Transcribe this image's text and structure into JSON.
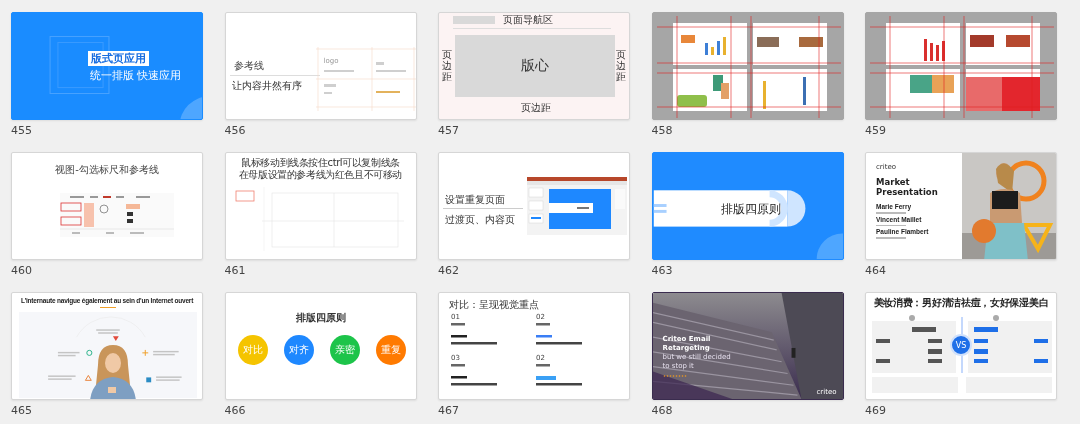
{
  "slides": [
    {
      "number": "455",
      "selected": false,
      "kind": "cover",
      "title": "版式页应用",
      "subtitle": "统一排版 快速应用"
    },
    {
      "number": "456",
      "selected": false,
      "kind": "guides",
      "title": "参考线",
      "subtitle": "让内容井然有序",
      "label": "logo"
    },
    {
      "number": "457",
      "selected": false,
      "kind": "margins",
      "nav": "页面导航区",
      "center": "版心",
      "left": "页边距",
      "right": "页边距",
      "bottom": "页边距"
    },
    {
      "number": "458",
      "selected": false,
      "kind": "collage"
    },
    {
      "number": "459",
      "selected": false,
      "kind": "redcollage"
    },
    {
      "number": "460",
      "selected": false,
      "kind": "ribbon",
      "title": "视图-勾选标尺和参考线"
    },
    {
      "number": "461",
      "selected": false,
      "kind": "notes",
      "lines": [
        "鼠标移动到线条按住ctrl可以复制线条",
        "在母版设置的参考线为红色且不可移动"
      ]
    },
    {
      "number": "462",
      "selected": false,
      "kind": "repeat",
      "title": "设置重复页面",
      "subtitle": "过渡页、内容页"
    },
    {
      "number": "463",
      "selected": false,
      "kind": "section",
      "title": "排版四原则"
    },
    {
      "number": "464",
      "selected": false,
      "kind": "market",
      "logo": "criteo",
      "title": "Market Presentation",
      "names": [
        "Marie Ferry",
        "Vincent Maillet",
        "Pauline Flambert"
      ]
    },
    {
      "number": "465",
      "selected": false,
      "kind": "internaute",
      "title": "L'internaute navigue également au sein d'un Internet ouvert"
    },
    {
      "number": "466",
      "selected": false,
      "kind": "principles",
      "title": "排版四原则",
      "circles": [
        {
          "label": "对比",
          "color": "#f5c400"
        },
        {
          "label": "对齐",
          "color": "#1e88ff"
        },
        {
          "label": "亲密",
          "color": "#1dc44a"
        },
        {
          "label": "重复",
          "color": "#ff7a00"
        }
      ]
    },
    {
      "number": "467",
      "selected": false,
      "kind": "contrast",
      "title": "对比：呈现视觉重点",
      "items": [
        "01",
        "02",
        "03",
        "02"
      ]
    },
    {
      "number": "468",
      "selected": false,
      "kind": "stairs",
      "title": "Criteo Email Retargeting",
      "subtitle": "but we still decided to stop it",
      "logo": "criteo"
    },
    {
      "number": "469",
      "selected": false,
      "kind": "beauty",
      "title": "美妆消费：男好清洁祛痘，女好保湿美白",
      "badge": "VS"
    }
  ]
}
